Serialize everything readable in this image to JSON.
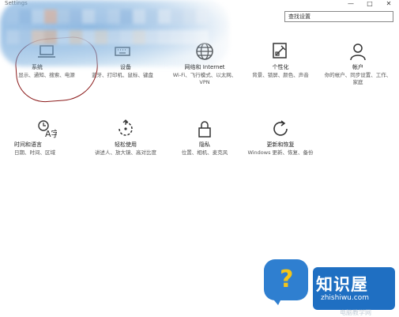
{
  "window": {
    "title": "Settings",
    "controls": [
      "—",
      "□",
      "✕"
    ]
  },
  "search": {
    "placeholder": "查找设置"
  },
  "tiles": [
    {
      "icon": "laptop-icon",
      "name": "系统",
      "desc": "显示、通知、搜索、电源"
    },
    {
      "icon": "keyboard-icon",
      "name": "设备",
      "desc": "蓝牙、打印机、鼠标、键盘"
    },
    {
      "icon": "globe-icon",
      "name": "网络和 Internet",
      "desc": "Wi-Fi、飞行模式、以太网、VPN"
    },
    {
      "icon": "personalization-icon",
      "name": "个性化",
      "desc": "背景、锁屏、颜色、声音"
    },
    {
      "icon": "user-icon",
      "name": "帐户",
      "desc": "你的帐户、同步设置、工作、家庭"
    },
    {
      "icon": "time-language-icon",
      "name": "时间和语言",
      "desc": "日期、时间、区域"
    },
    {
      "icon": "ease-of-access-icon",
      "name": "轻松使用",
      "desc": "讲述人、放大镜、高对比度"
    },
    {
      "icon": "lock-icon",
      "name": "隐私",
      "desc": "位置、相机、麦克风"
    },
    {
      "icon": "update-icon",
      "name": "更新和恢复",
      "desc": "Windows 更新、恢复、备份"
    }
  ],
  "watermark": {
    "title": "知识屋",
    "url": "zhishiwu.com",
    "bottom": "电脑教学网",
    "colors": {
      "bubble": "#2f7fd0",
      "question": "#f5c518"
    }
  }
}
